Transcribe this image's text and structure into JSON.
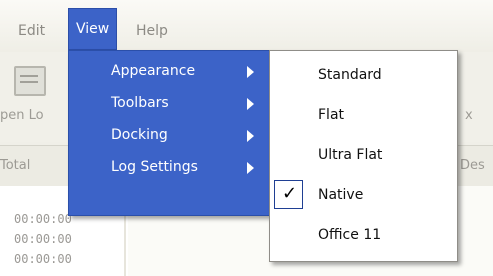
{
  "menubar": {
    "edit": "Edit",
    "view": "View",
    "help": "Help"
  },
  "toolbar": {
    "open_label_fragment": "pen Lo",
    "right_fragment": "x"
  },
  "list": {
    "left_header_fragment": "Total",
    "right_header_fragment": "Des",
    "times": [
      "00:00:00",
      "00:00:00",
      "00:00:00"
    ]
  },
  "view_menu": {
    "items": [
      {
        "label": "Appearance"
      },
      {
        "label": "Toolbars"
      },
      {
        "label": "Docking"
      },
      {
        "label": "Log Settings"
      }
    ]
  },
  "appearance_menu": {
    "items": [
      {
        "label": "Standard",
        "checked": false
      },
      {
        "label": "Flat",
        "checked": false
      },
      {
        "label": "Ultra Flat",
        "checked": false
      },
      {
        "label": "Native",
        "checked": true
      },
      {
        "label": "Office 11",
        "checked": false
      }
    ]
  },
  "icons": {
    "checkmark": "✓"
  },
  "colors": {
    "menu_highlight": "#3c63c8"
  }
}
